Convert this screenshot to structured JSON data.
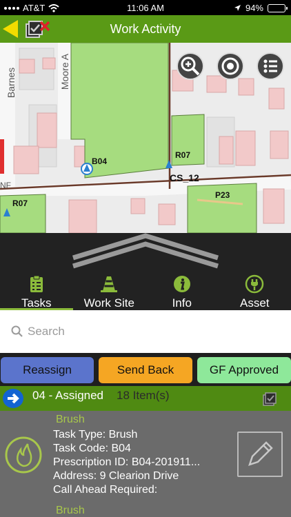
{
  "status": {
    "carrier": "AT&T",
    "time": "11:06 AM",
    "battery": "94%",
    "battery_level": 0.94
  },
  "header": {
    "title": "Work Activity",
    "back_icon": "back-arrow-icon",
    "tasks_icon": "task-checklist-icon"
  },
  "map": {
    "labels": {
      "street1": "Barnes",
      "street2": "Moore A",
      "b04": "B04",
      "r07a": "R07",
      "cs12": "CS_12",
      "p23": "P23",
      "r07b": "R07",
      "nf": "NF"
    },
    "buttons": [
      "zoom-in-icon",
      "locate-target-icon",
      "layers-list-icon"
    ]
  },
  "tabs": [
    {
      "label": "Tasks",
      "icon": "clipboard-icon",
      "active": true
    },
    {
      "label": "Work Site",
      "icon": "traffic-cone-icon",
      "active": false
    },
    {
      "label": "Info",
      "icon": "info-icon",
      "active": false
    },
    {
      "label": "Asset",
      "icon": "plug-icon",
      "active": false
    }
  ],
  "search": {
    "placeholder": "Search"
  },
  "actions": [
    {
      "label": "Reassign",
      "color": "#5b74cc"
    },
    {
      "label": "Send Back",
      "color": "#f5a623"
    },
    {
      "label": "GF Approved",
      "color": "#8ee89a"
    }
  ],
  "group": {
    "title": "04 - Assigned",
    "count": "18 Item(s)"
  },
  "tasks": [
    {
      "name": "Brush",
      "type": "Task Type: Brush",
      "code": "Task Code: B04",
      "prescription": "Prescription ID: B04-201911...",
      "address": "Address: 9 Clearion Drive",
      "call_ahead": "Call Ahead Required:"
    },
    {
      "name": "Brush"
    }
  ],
  "colors": {
    "green_bar": "#5a9a16",
    "group_bar": "#4f8a12",
    "accent_yellow": "#f2dc00",
    "card_bg": "#6b6b6b",
    "task_name": "#a8c74b"
  }
}
